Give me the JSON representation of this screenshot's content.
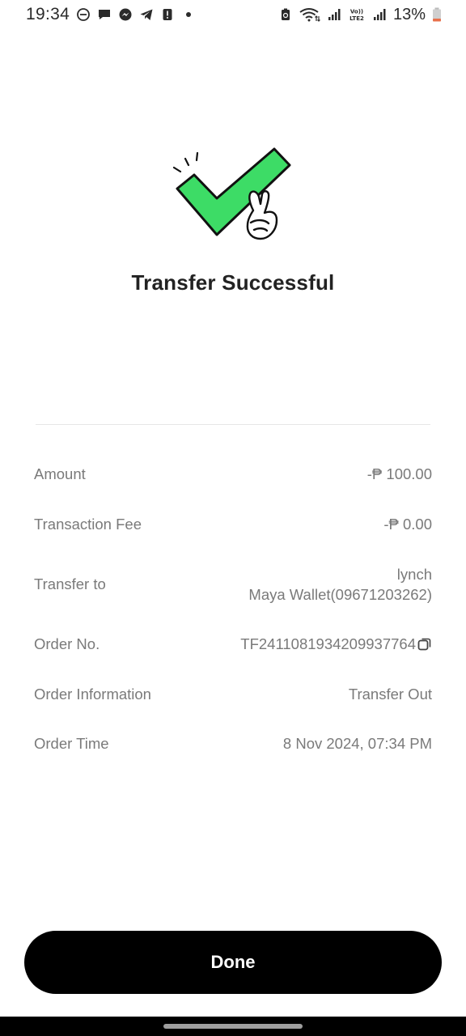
{
  "status_bar": {
    "time": "19:34",
    "left_icons": [
      "do-not-disturb-icon",
      "chat-bubble-icon",
      "messenger-icon",
      "telegram-icon",
      "alert-icon",
      "dot-icon"
    ],
    "right_icons": [
      "battery-saver-icon",
      "wifi-icon",
      "signal-icon",
      "volte-lte2-icon",
      "signal-icon"
    ],
    "battery_percent": "13%"
  },
  "hero": {
    "icon": "success-checkmark-icon",
    "check_color": "#3ddc66"
  },
  "title": "Transfer Successful",
  "details": {
    "amount": {
      "label": "Amount",
      "value": "-₱ 100.00"
    },
    "fee": {
      "label": "Transaction Fee",
      "value": "-₱ 0.00"
    },
    "transfer_to": {
      "label": "Transfer to",
      "name": "lynch",
      "account": "Maya Wallet(09671203262)"
    },
    "order_no": {
      "label": "Order No.",
      "value": "TF2411081934209937764"
    },
    "order_info": {
      "label": "Order Information",
      "value": "Transfer Out"
    },
    "order_time": {
      "label": "Order Time",
      "value": "8 Nov 2024, 07:34 PM"
    }
  },
  "done_button": {
    "label": "Done"
  }
}
